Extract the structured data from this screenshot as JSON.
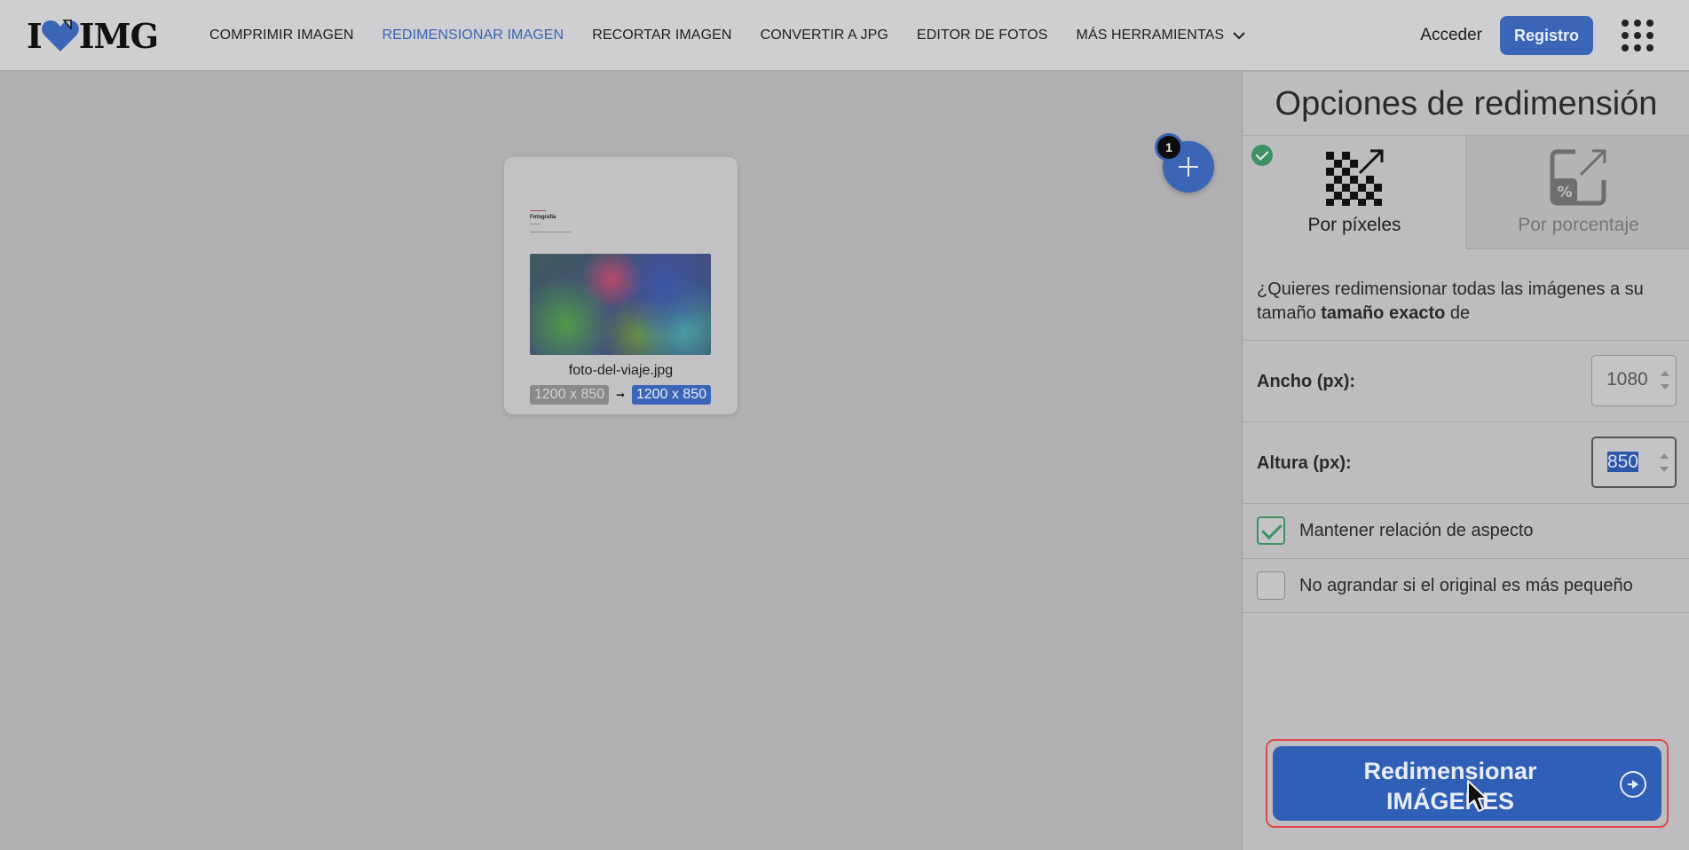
{
  "brand": {
    "logo_left": "I",
    "logo_right": "IMG"
  },
  "nav": {
    "items": [
      {
        "label": "COMPRIMIR IMAGEN",
        "active": false
      },
      {
        "label": "REDIMENSIONAR IMAGEN",
        "active": true
      },
      {
        "label": "RECORTAR IMAGEN",
        "active": false
      },
      {
        "label": "CONVERTIR A JPG",
        "active": false
      },
      {
        "label": "EDITOR DE FOTOS",
        "active": false
      }
    ],
    "more_label": "MÁS HERRAMIENTAS",
    "login_label": "Acceder",
    "register_label": "Registro"
  },
  "workspace": {
    "file": {
      "name": "foto-del-viaje.jpg",
      "thumb_title": "Fotografía",
      "original_dims": "1200 x 850",
      "new_dims": "1200 x 850"
    },
    "file_count": "1"
  },
  "sidebar": {
    "title": "Opciones de redimensión",
    "tabs": [
      {
        "label": "Por píxeles",
        "active": true
      },
      {
        "label": "Por porcentaje",
        "active": false
      }
    ],
    "question_part1": "¿Quieres redimensionar todas las imágenes a su tamaño ",
    "question_bold": "tamaño exacto",
    "question_part2": " de",
    "width_label": "Ancho (px):",
    "width_value": "1080",
    "height_label": "Altura (px):",
    "height_value": "850",
    "keep_ratio_label": "Mantener relación de aspecto",
    "keep_ratio_checked": true,
    "no_enlarge_label": "No agrandar si el original es más pequeño",
    "no_enlarge_checked": false,
    "action_label": "Redimensionar IMÁGENES"
  },
  "colors": {
    "accent": "#3b66b8",
    "success": "#3e9163",
    "highlight": "#e04848"
  }
}
